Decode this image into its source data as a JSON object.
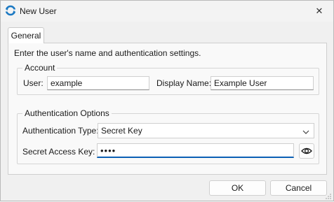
{
  "window": {
    "title": "New User",
    "icon": "sync-app-icon",
    "close_glyph": "✕"
  },
  "tabs": [
    {
      "label": "General",
      "selected": true
    }
  ],
  "intro_text": "Enter the user's name and authentication settings.",
  "account": {
    "legend": "Account",
    "user_label": "User:",
    "user_value": "example",
    "display_name_label": "Display Name:",
    "display_name_value": "Example User"
  },
  "auth": {
    "legend": "Authentication Options",
    "type_label": "Authentication Type:",
    "type_value": "Secret Key",
    "secret_label": "Secret Access Key:",
    "secret_value": "••••",
    "reveal_icon": "eye-icon"
  },
  "buttons": {
    "ok_label": "OK",
    "cancel_label": "Cancel"
  },
  "colors": {
    "accent": "#0a5fb4",
    "icon_blue": "#1a78c2"
  }
}
